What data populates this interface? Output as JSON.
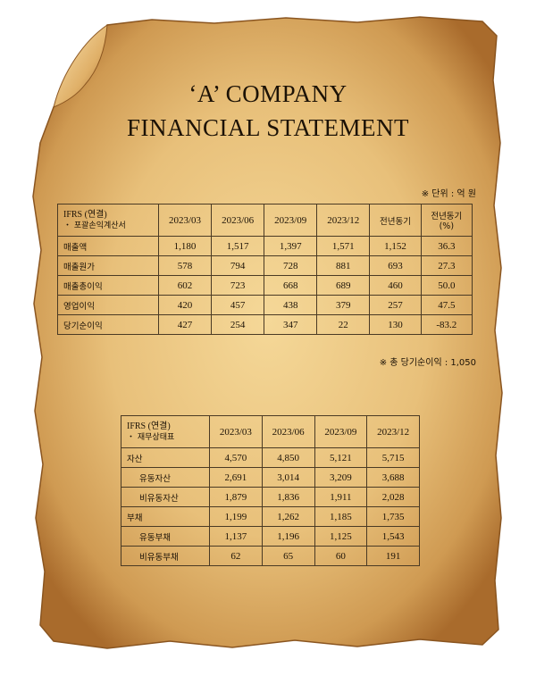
{
  "document": {
    "title_line1": "‘A’ COMPANY",
    "title_line2": "FINANCIAL STATEMENT",
    "unit_note": "※ 단위 : 억 원",
    "total_net_income_note": "※ 총 당기순이익 : 1,050"
  },
  "income_statement": {
    "header_line1": "IFRS (연결)",
    "header_line2": "・ 포괄손익계산서",
    "columns": [
      "2023/03",
      "2023/06",
      "2023/09",
      "2023/12",
      "전년동기",
      "전년동기\n(%)"
    ],
    "rows": [
      {
        "label": "매출액",
        "values": [
          "1,180",
          "1,517",
          "1,397",
          "1,571",
          "1,152",
          "36.3"
        ]
      },
      {
        "label": "매출원가",
        "values": [
          "578",
          "794",
          "728",
          "881",
          "693",
          "27.3"
        ]
      },
      {
        "label": "매출총이익",
        "values": [
          "602",
          "723",
          "668",
          "689",
          "460",
          "50.0"
        ]
      },
      {
        "label": "영업이익",
        "values": [
          "420",
          "457",
          "438",
          "379",
          "257",
          "47.5"
        ]
      },
      {
        "label": "당기순이익",
        "values": [
          "427",
          "254",
          "347",
          "22",
          "130",
          "-83.2"
        ]
      }
    ]
  },
  "balance_sheet": {
    "header_line1": "IFRS (연결)",
    "header_line2": "・ 재무상태표",
    "columns": [
      "2023/03",
      "2023/06",
      "2023/09",
      "2023/12"
    ],
    "rows": [
      {
        "label": "자산",
        "values": [
          "4,570",
          "4,850",
          "5,121",
          "5,715"
        ],
        "indent": false
      },
      {
        "label": "유동자산",
        "values": [
          "2,691",
          "3,014",
          "3,209",
          "3,688"
        ],
        "indent": true
      },
      {
        "label": "비유동자산",
        "values": [
          "1,879",
          "1,836",
          "1,911",
          "2,028"
        ],
        "indent": true
      },
      {
        "label": "부채",
        "values": [
          "1,199",
          "1,262",
          "1,185",
          "1,735"
        ],
        "indent": false
      },
      {
        "label": "유동부채",
        "values": [
          "1,137",
          "1,196",
          "1,125",
          "1,543"
        ],
        "indent": true
      },
      {
        "label": "비유동부채",
        "values": [
          "62",
          "65",
          "60",
          "191"
        ],
        "indent": true
      }
    ]
  },
  "colors": {
    "paper_light": "#f1d08f",
    "paper_mid": "#dcae64",
    "paper_edge": "#9a5f22",
    "text": "#1c1206"
  }
}
